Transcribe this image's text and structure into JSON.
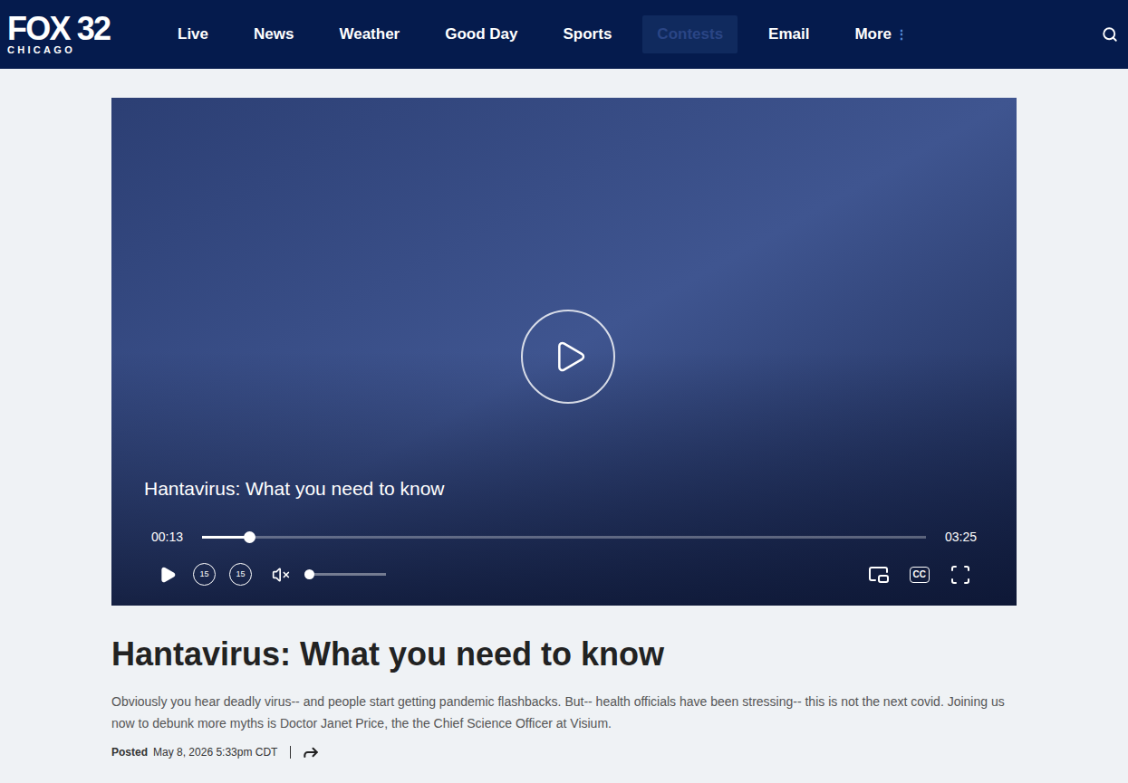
{
  "nav": {
    "logo": {
      "main": "FOX 32",
      "sub": "CHICAGO"
    },
    "items": [
      {
        "label": "Live",
        "selected": false
      },
      {
        "label": "News",
        "selected": false
      },
      {
        "label": "Weather",
        "selected": false
      },
      {
        "label": "Good Day",
        "selected": false
      },
      {
        "label": "Sports",
        "selected": false
      },
      {
        "label": "Contests",
        "selected": true
      },
      {
        "label": "Email",
        "selected": false
      }
    ],
    "more": {
      "label": "More",
      "glyph": "⋮"
    }
  },
  "video": {
    "caption": "Hantavirus: What you need to know",
    "elapsed": "00:13",
    "duration": "03:25",
    "progress": 0.065,
    "playing": false,
    "muted": true,
    "volume": 0,
    "skip_back": "15",
    "skip_forward": "15",
    "captions_label": "CC"
  },
  "article": {
    "title": "Hantavirus: What you need to know",
    "description": "Obviously you hear deadly virus-- and people start getting pandemic flashbacks.  But-- health officials have been stressing-- this is not the next covid.  Joining us now to debunk more myths is Doctor Janet Price, the the Chief Science Officer at Visium.",
    "posted_label": "Posted",
    "posted_date": "May 8, 2026 5:33pm CDT"
  }
}
